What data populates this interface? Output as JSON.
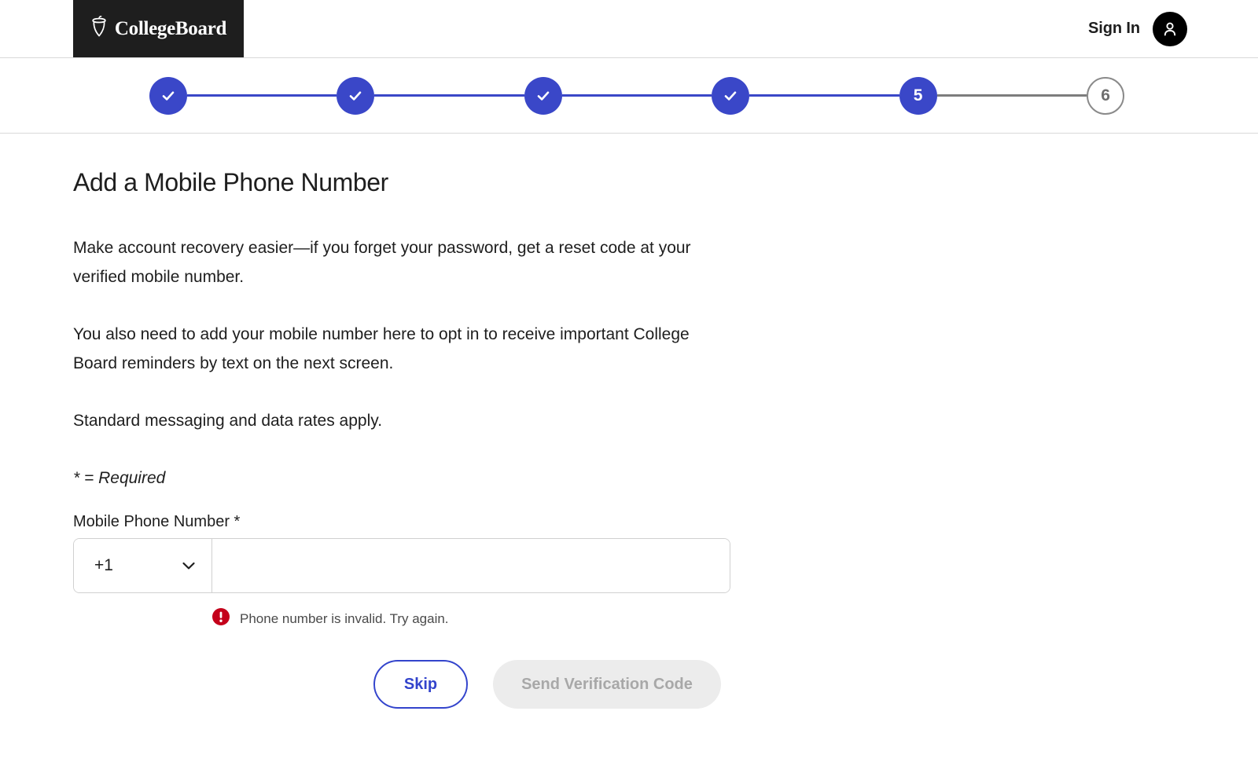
{
  "header": {
    "logo_text": "CollegeBoard",
    "logo_icon": "acorn-icon",
    "signin_label": "Sign In",
    "avatar_icon": "user-avatar-icon",
    "logo_background": "#1e1e1e"
  },
  "stepper": {
    "accent_color": "#3a47c8",
    "inactive_color": "#7d7d7d",
    "steps": [
      {
        "label": "1",
        "state": "done",
        "glyph": "check-icon"
      },
      {
        "label": "2",
        "state": "done",
        "glyph": "check-icon"
      },
      {
        "label": "3",
        "state": "done",
        "glyph": "check-icon"
      },
      {
        "label": "4",
        "state": "done",
        "glyph": "check-icon"
      },
      {
        "label": "5",
        "state": "current",
        "glyph": "5"
      },
      {
        "label": "6",
        "state": "upcoming",
        "glyph": "6"
      }
    ]
  },
  "main": {
    "title": "Add a Mobile Phone Number",
    "paragraph_1": "Make account recovery easier—if you forget your password, get a reset code at your verified mobile number.",
    "paragraph_2": "You also need to add your mobile number here to opt in to receive important College Board reminders by text on the next screen.",
    "paragraph_3": "Standard messaging and data rates apply.",
    "required_note": "* = Required"
  },
  "form": {
    "phone_label": "Mobile Phone Number *",
    "country_code": "+1",
    "country_chevron": "chevron-down-icon",
    "phone_value": "",
    "phone_placeholder": "",
    "error_icon": "error-exclamation-icon",
    "error_color": "#c4001a",
    "error_message": "Phone number is invalid. Try again."
  },
  "actions": {
    "skip_label": "Skip",
    "send_label": "Send Verification Code",
    "skip_color": "#3344cc",
    "send_disabled_bg": "#ececec"
  }
}
